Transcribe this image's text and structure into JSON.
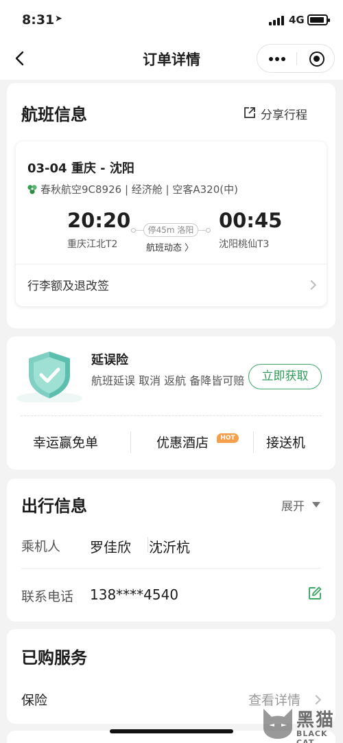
{
  "status_bar": {
    "time": "8:31",
    "location_icon": "location-arrow-icon",
    "network": "4G"
  },
  "nav": {
    "title": "订单详情"
  },
  "flight_section": {
    "title": "航班信息",
    "share_label": "分享行程",
    "route": "03-04 重庆 - 沈阳",
    "airline_info": "春秋航空9C8926 | 经济舱 | 空客A320(中)",
    "departure_time": "20:20",
    "departure_airport": "重庆江北T2",
    "arrival_time": "00:45",
    "arrival_airport": "沈阳桃仙T3",
    "stopover": "停45m 洛阳",
    "dynamic_link": "航班动态 〉",
    "baggage_label": "行李额及退改签"
  },
  "insurance": {
    "title": "延误险",
    "description": "航班延误 取消 返航 备降皆可赔",
    "button": "立即获取",
    "quick_links": [
      "幸运赢免单",
      "优惠酒店",
      "接送机"
    ],
    "hot_badge": "HOT",
    "accent_color": "#3aa763"
  },
  "travel_section": {
    "title": "出行信息",
    "expand_label": "展开",
    "passenger_label": "乘机人",
    "passengers": [
      "罗佳欣",
      "沈沂杭"
    ],
    "phone_label": "联系电话",
    "phone": "138****4540"
  },
  "service_section": {
    "title": "已购服务",
    "item_label": "保险",
    "detail_link": "查看详情"
  },
  "watermark": {
    "title": "黑猫",
    "subtitle": "BLACK CAT"
  }
}
